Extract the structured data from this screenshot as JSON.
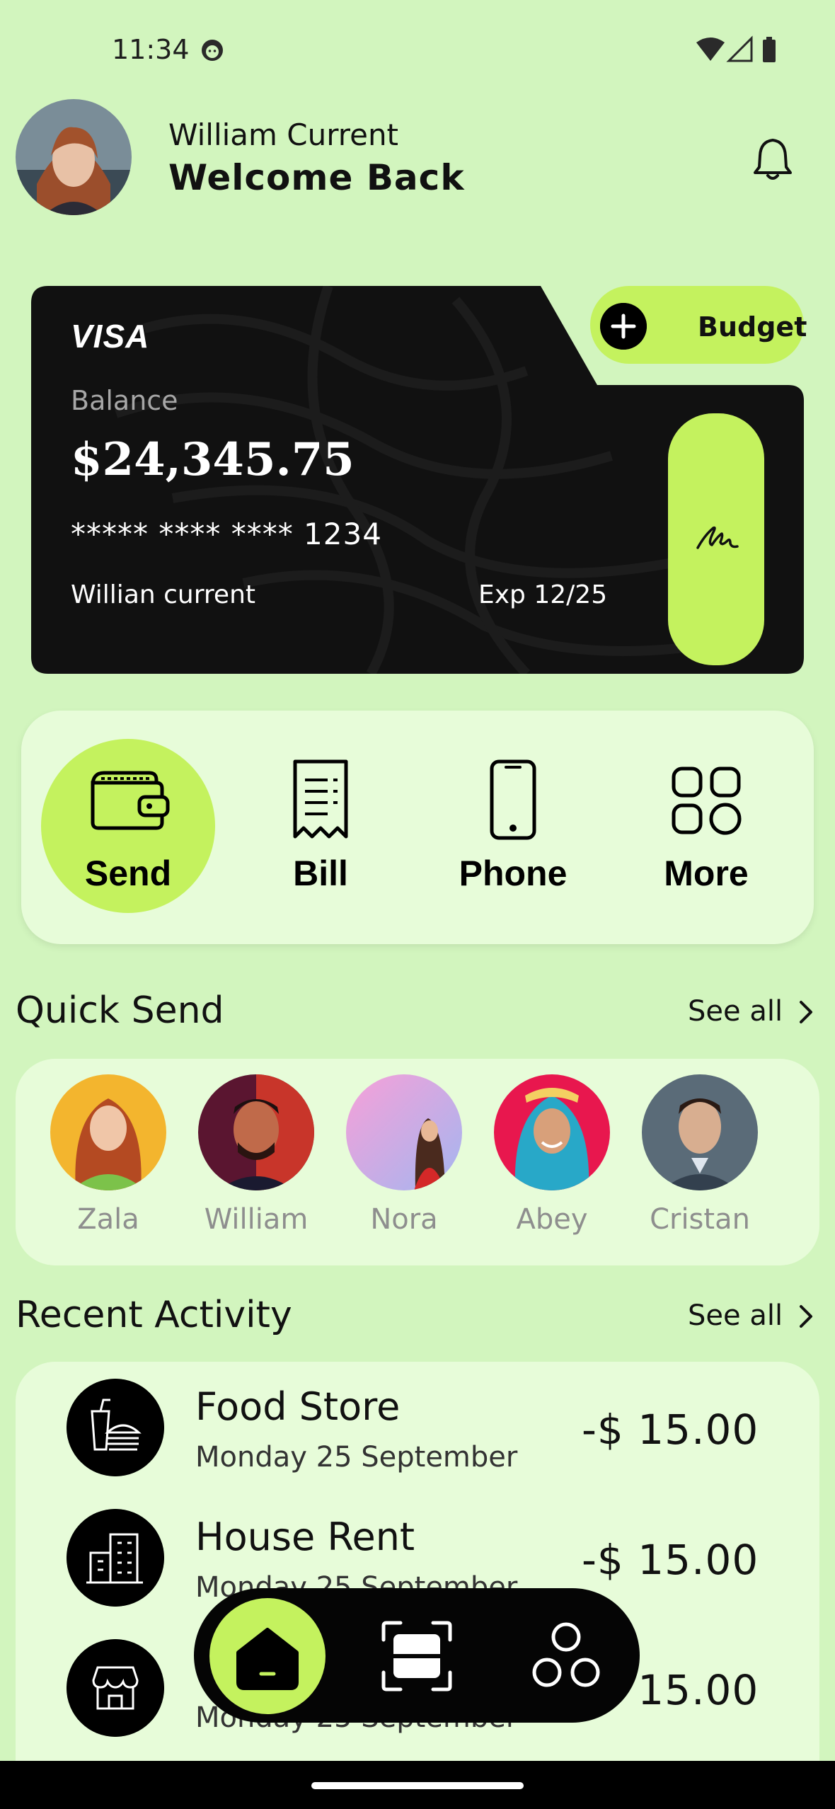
{
  "status_bar": {
    "time": "11:34",
    "icons": [
      "face-icon",
      "wifi-icon",
      "signal-icon",
      "battery-icon"
    ]
  },
  "header": {
    "user_name": "William Current",
    "greeting": "Welcome Back",
    "avatar": "avatar-icon",
    "notification_icon": "bell-icon"
  },
  "card": {
    "brand": "VISA",
    "balance_label": "Balance",
    "balance": "$24,345.75",
    "number": "***** **** **** 1234",
    "holder": "Willian current",
    "expiry": "Exp 12/25",
    "budget_label": "Budget",
    "accent": "#c4f25e"
  },
  "actions": [
    {
      "label": "Send",
      "icon": "wallet-icon",
      "active": true
    },
    {
      "label": "Bill",
      "icon": "receipt-icon",
      "active": false
    },
    {
      "label": "Phone",
      "icon": "phone-icon",
      "active": false
    },
    {
      "label": "More",
      "icon": "grid-icon",
      "active": false
    }
  ],
  "quick_send": {
    "title": "Quick Send",
    "see_all": "See all",
    "contacts": [
      {
        "name": "Zala"
      },
      {
        "name": "William"
      },
      {
        "name": "Nora"
      },
      {
        "name": "Abey"
      },
      {
        "name": "Cristan"
      }
    ]
  },
  "recent_activity": {
    "title": "Recent Activity",
    "see_all": "See all",
    "items": [
      {
        "title": "Food Store",
        "date": "Monday 25 September",
        "amount": "-$ 15.00",
        "icon": "food-icon"
      },
      {
        "title": "House Rent",
        "date": "Monday 25 September",
        "amount": "-$ 15.00",
        "icon": "building-icon"
      },
      {
        "title": "",
        "date": "Monday 25 September",
        "amount": "-$ 15.00",
        "icon": "store-icon"
      }
    ]
  },
  "bottom_nav": {
    "items": [
      "home-icon",
      "scan-icon",
      "circles-icon"
    ]
  },
  "colors": {
    "background": "#d2f5be",
    "panel": "#e7fcd9",
    "accent": "#c4f25e",
    "dark": "#0b0b0b"
  }
}
